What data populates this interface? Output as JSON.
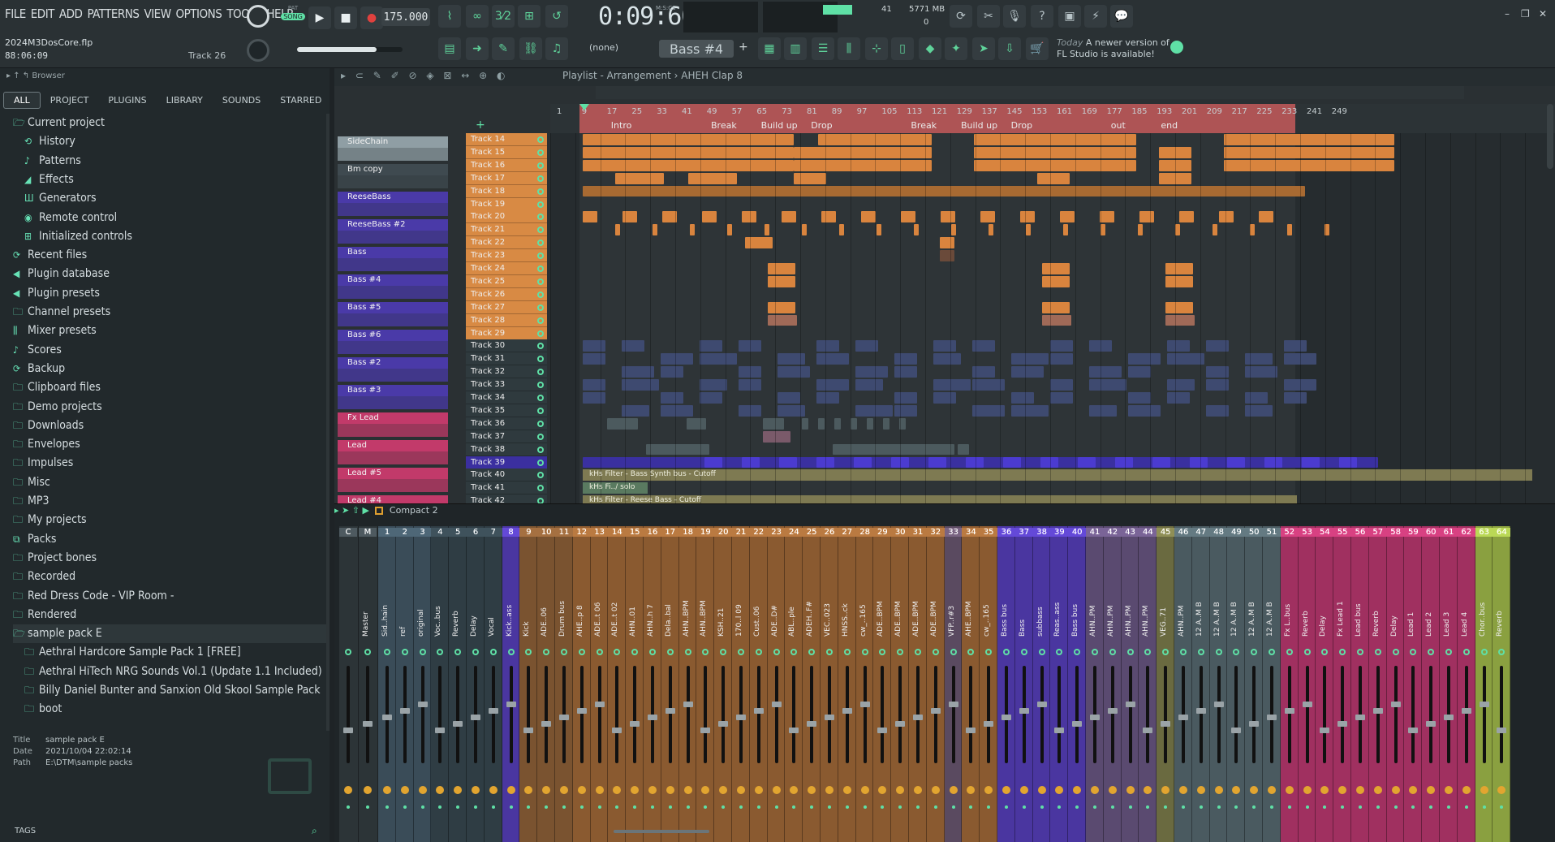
{
  "menu": [
    "FILE",
    "EDIT",
    "ADD",
    "PATTERNS",
    "VIEW",
    "OPTIONS",
    "TOOLS",
    "HELP"
  ],
  "transport": {
    "pat_label": "PAT",
    "song_label": "SONG",
    "tempo": "175.000",
    "time": "0:09:60",
    "time_unit": "M:S:CS",
    "cpu": "41",
    "memory": "5771 MB",
    "voices": "0"
  },
  "project": {
    "file": "2024M3DosCore.flp",
    "time": "88:06:09",
    "track": "Track 26"
  },
  "toolbar2": {
    "none_label": "(none)",
    "pattern": "Bass #4",
    "news_date": "Today",
    "news_text1": "A newer version of",
    "news_text2": "FL Studio is available!"
  },
  "browser": {
    "title": "Browser",
    "tabs": [
      "ALL",
      "PROJECT",
      "PLUGINS",
      "LIBRARY",
      "SOUNDS",
      "STARRED"
    ],
    "active_tab": "ALL",
    "tree": [
      {
        "label": "Current project",
        "level": 0,
        "icon": "folder-open-icon"
      },
      {
        "label": "History",
        "level": 1,
        "icon": "history-icon"
      },
      {
        "label": "Patterns",
        "level": 1,
        "icon": "note-icon"
      },
      {
        "label": "Effects",
        "level": 1,
        "icon": "effects-icon"
      },
      {
        "label": "Generators",
        "level": 1,
        "icon": "generators-icon"
      },
      {
        "label": "Remote control",
        "level": 1,
        "icon": "remote-icon"
      },
      {
        "label": "Initialized controls",
        "level": 1,
        "icon": "controls-icon"
      },
      {
        "label": "Recent files",
        "level": 0,
        "icon": "recent-icon"
      },
      {
        "label": "Plugin database",
        "level": 0,
        "icon": "plugin-icon"
      },
      {
        "label": "Plugin presets",
        "level": 0,
        "icon": "plugin-icon"
      },
      {
        "label": "Channel presets",
        "level": 0,
        "icon": "folder-icon"
      },
      {
        "label": "Mixer presets",
        "level": 0,
        "icon": "mixer-icon"
      },
      {
        "label": "Scores",
        "level": 0,
        "icon": "note-icon"
      },
      {
        "label": "Backup",
        "level": 0,
        "icon": "backup-icon"
      },
      {
        "label": "Clipboard files",
        "level": 0,
        "icon": "folder-icon"
      },
      {
        "label": "Demo projects",
        "level": 0,
        "icon": "folder-icon"
      },
      {
        "label": "Downloads",
        "level": 0,
        "icon": "folder-icon"
      },
      {
        "label": "Envelopes",
        "level": 0,
        "icon": "folder-icon"
      },
      {
        "label": "Impulses",
        "level": 0,
        "icon": "folder-icon"
      },
      {
        "label": "Misc",
        "level": 0,
        "icon": "folder-icon"
      },
      {
        "label": "MP3",
        "level": 0,
        "icon": "folder-icon"
      },
      {
        "label": "My projects",
        "level": 0,
        "icon": "folder-icon"
      },
      {
        "label": "Packs",
        "level": 0,
        "icon": "packs-icon"
      },
      {
        "label": "Project bones",
        "level": 0,
        "icon": "folder-icon"
      },
      {
        "label": "Recorded",
        "level": 0,
        "icon": "folder-icon"
      },
      {
        "label": "Red Dress Code - VIP Room -",
        "level": 0,
        "icon": "folder-icon"
      },
      {
        "label": "Rendered",
        "level": 0,
        "icon": "folder-icon"
      },
      {
        "label": "sample pack E",
        "level": 0,
        "icon": "folder-open-icon"
      },
      {
        "label": "Aethral Hardcore Sample Pack 1 [FREE]",
        "level": 1,
        "icon": "folder-icon"
      },
      {
        "label": "Aethral HiTech NRG Sounds Vol.1 (Update 1.1 Included)",
        "level": 1,
        "icon": "folder-icon"
      },
      {
        "label": "Billy Daniel Bunter and Sanxion Old Skool Sample Pack",
        "level": 1,
        "icon": "folder-icon"
      },
      {
        "label": "boot",
        "level": 1,
        "icon": "folder-icon"
      }
    ],
    "info": {
      "title_k": "Title",
      "title": "sample pack E",
      "date_k": "Date",
      "date": "2021/10/04 22:02:14",
      "path_k": "Path",
      "path": "E:\\DTM\\sample packs"
    },
    "tags_label": "TAGS"
  },
  "playlist": {
    "title": "Playlist - Arrangement › AHEH Clap 8",
    "ruler": [
      "1",
      "9",
      "17",
      "25",
      "33",
      "41",
      "49",
      "57",
      "65",
      "73",
      "81",
      "89",
      "97",
      "105",
      "113",
      "121",
      "129",
      "137",
      "145",
      "153",
      "161",
      "169",
      "177",
      "185",
      "193",
      "201",
      "209",
      "217",
      "225",
      "233",
      "241",
      "249"
    ],
    "markers": [
      {
        "label": "Intro",
        "bar": 9
      },
      {
        "label": "Break",
        "bar": 41
      },
      {
        "label": "Build up",
        "bar": 57
      },
      {
        "label": "Drop",
        "bar": 73
      },
      {
        "label": "Break",
        "bar": 105
      },
      {
        "label": "Build up",
        "bar": 121
      },
      {
        "label": "Drop",
        "bar": 137
      },
      {
        "label": "out",
        "bar": 169
      },
      {
        "label": "end",
        "bar": 185
      }
    ],
    "channels": [
      {
        "name": "SideChain",
        "color": "#8f9ea4"
      },
      {
        "name": "Bm copy",
        "color": "#3f4a50"
      },
      {
        "name": "ReeseBass",
        "color": "#4a3aa8"
      },
      {
        "name": "ReeseBass #2",
        "color": "#4a3aa8"
      },
      {
        "name": "Bass",
        "color": "#4a3aa8"
      },
      {
        "name": "Bass #4",
        "color": "#4a3aa8"
      },
      {
        "name": "Bass #5",
        "color": "#4a3aa8"
      },
      {
        "name": "Bass #6",
        "color": "#4a3aa8"
      },
      {
        "name": "Bass #2",
        "color": "#4a3aa8"
      },
      {
        "name": "Bass #3",
        "color": "#4a3aa8"
      },
      {
        "name": "Fx Lead",
        "color": "#c23a6a"
      },
      {
        "name": "Lead",
        "color": "#c23a6a"
      },
      {
        "name": "Lead #5",
        "color": "#c23a6a"
      },
      {
        "name": "Lead #4",
        "color": "#c23a6a"
      }
    ],
    "tracks": [
      "Track 14",
      "Track 15",
      "Track 16",
      "Track 17",
      "Track 18",
      "Track 19",
      "Track 20",
      "Track 21",
      "Track 22",
      "Track 23",
      "Track 24",
      "Track 25",
      "Track 26",
      "Track 27",
      "Track 28",
      "Track 29",
      "Track 30",
      "Track 31",
      "Track 32",
      "Track 33",
      "Track 34",
      "Track 35",
      "Track 36",
      "Track 37",
      "Track 38",
      "Track 39",
      "Track 40",
      "Track 41",
      "Track 42"
    ],
    "automation": [
      "kHs Filter - Bass Synth bus - Cutoff",
      "kHs Fi../ solo",
      "kHs Filter - Reese Bass - Cutoff"
    ],
    "clip_labels": [
      "AHN1..BPM",
      "AHN1..BPM",
      "AHN1.5..BPM",
      "AHN1.5..BPM",
      "AHN..BPM",
      "AHN1..BPM",
      "AHN1..BPM"
    ]
  },
  "mixer": {
    "view": "Compact 2",
    "strips": [
      {
        "num": "C",
        "name": "",
        "color": "#2c3437"
      },
      {
        "num": "M",
        "name": "Master",
        "color": "#2c3437"
      },
      {
        "num": "1",
        "name": "Sid..hain",
        "color": "#3a4c58"
      },
      {
        "num": "2",
        "name": "ref",
        "color": "#3a4c58"
      },
      {
        "num": "3",
        "name": "original",
        "color": "#3a4c58"
      },
      {
        "num": "4",
        "name": "Voc..bus",
        "color": "#2f3d44"
      },
      {
        "num": "5",
        "name": "Reverb",
        "color": "#2f3d44"
      },
      {
        "num": "6",
        "name": "Delay",
        "color": "#2f3d44"
      },
      {
        "num": "7",
        "name": "Vocal",
        "color": "#2f3d44"
      },
      {
        "num": "8",
        "name": "Kick..ass",
        "color": "#4a36a0"
      },
      {
        "num": "9",
        "name": "Kick",
        "color": "#7a5330"
      },
      {
        "num": "10",
        "name": "ADE..06",
        "color": "#7a5330"
      },
      {
        "num": "11",
        "name": "Drum bus",
        "color": "#7a5330"
      },
      {
        "num": "12",
        "name": "AHE..p 8",
        "color": "#8a5a30"
      },
      {
        "num": "13",
        "name": "ADE..t 06",
        "color": "#8a5a30"
      },
      {
        "num": "14",
        "name": "ADE..t 02",
        "color": "#8a5a30"
      },
      {
        "num": "15",
        "name": "AHN..01",
        "color": "#8a5a30"
      },
      {
        "num": "16",
        "name": "AHN..h 7",
        "color": "#8a5a30"
      },
      {
        "num": "17",
        "name": "Dela..bal",
        "color": "#8a5a30"
      },
      {
        "num": "18",
        "name": "AHN..BPM",
        "color": "#8a5a30"
      },
      {
        "num": "19",
        "name": "AHN..BPM",
        "color": "#8a5a30"
      },
      {
        "num": "20",
        "name": "KSH..21",
        "color": "#8a5a30"
      },
      {
        "num": "21",
        "name": "170..l 09",
        "color": "#8a5a30"
      },
      {
        "num": "22",
        "name": "Cust..06",
        "color": "#8a5a30"
      },
      {
        "num": "23",
        "name": "ADE..D#",
        "color": "#8a5a30"
      },
      {
        "num": "24",
        "name": "ABL..ple",
        "color": "#8a5a30"
      },
      {
        "num": "25",
        "name": "ADEH..F#",
        "color": "#8a5a30"
      },
      {
        "num": "26",
        "name": "VEC..023",
        "color": "#8a5a30"
      },
      {
        "num": "27",
        "name": "HNSS..ck",
        "color": "#8a5a30"
      },
      {
        "num": "28",
        "name": "cw_..165",
        "color": "#8a5a30"
      },
      {
        "num": "29",
        "name": "ADE..BPM",
        "color": "#8a5a30"
      },
      {
        "num": "30",
        "name": "ADE..BPM",
        "color": "#8a5a30"
      },
      {
        "num": "31",
        "name": "ADE..BPM",
        "color": "#8a5a30"
      },
      {
        "num": "32",
        "name": "ADE..BPM",
        "color": "#8a5a30"
      },
      {
        "num": "33",
        "name": "VFP..r#3",
        "color": "#5a4a60"
      },
      {
        "num": "34",
        "name": "AHE..BPM",
        "color": "#8a5a30"
      },
      {
        "num": "35",
        "name": "cw_..165",
        "color": "#8a5a30"
      },
      {
        "num": "36",
        "name": "Bass bus",
        "color": "#4a36a0"
      },
      {
        "num": "37",
        "name": "Bass",
        "color": "#4a36a0"
      },
      {
        "num": "38",
        "name": "subbass",
        "color": "#4a36a0"
      },
      {
        "num": "39",
        "name": "Reas..ass",
        "color": "#4a36a0"
      },
      {
        "num": "40",
        "name": "Bass bus",
        "color": "#4a36a0"
      },
      {
        "num": "41",
        "name": "AHN..PM",
        "color": "#5a4a70"
      },
      {
        "num": "42",
        "name": "AHN..PM",
        "color": "#5a4a70"
      },
      {
        "num": "43",
        "name": "AHN..PM",
        "color": "#5a4a70"
      },
      {
        "num": "44",
        "name": "AHN..PM",
        "color": "#5a4a70"
      },
      {
        "num": "45",
        "name": "VEG..71",
        "color": "#6a6a40"
      },
      {
        "num": "46",
        "name": "AHN..PM",
        "color": "#4a5a60"
      },
      {
        "num": "47",
        "name": "12 A..M B",
        "color": "#4a5a60"
      },
      {
        "num": "48",
        "name": "12 A..M B",
        "color": "#4a5a60"
      },
      {
        "num": "49",
        "name": "12 A..M B",
        "color": "#4a5a60"
      },
      {
        "num": "50",
        "name": "12 A..M B",
        "color": "#4a5a60"
      },
      {
        "num": "51",
        "name": "12 A..M B",
        "color": "#4a5a60"
      },
      {
        "num": "52",
        "name": "Fx L..bus",
        "color": "#a03060"
      },
      {
        "num": "53",
        "name": "Reverb",
        "color": "#a03060"
      },
      {
        "num": "54",
        "name": "Delay",
        "color": "#a03060"
      },
      {
        "num": "55",
        "name": "Fx Lead 1",
        "color": "#a03060"
      },
      {
        "num": "56",
        "name": "Lead bus",
        "color": "#a03060"
      },
      {
        "num": "57",
        "name": "Reverb",
        "color": "#a03060"
      },
      {
        "num": "58",
        "name": "Delay",
        "color": "#a03060"
      },
      {
        "num": "59",
        "name": "Lead 1",
        "color": "#a03060"
      },
      {
        "num": "60",
        "name": "Lead 2",
        "color": "#a03060"
      },
      {
        "num": "61",
        "name": "Lead 3",
        "color": "#a03060"
      },
      {
        "num": "62",
        "name": "Lead 4",
        "color": "#a03060"
      },
      {
        "num": "63",
        "name": "Chor..bus",
        "color": "#8aa040"
      },
      {
        "num": "64",
        "name": "Reverb",
        "color": "#8aa040"
      }
    ]
  },
  "colors": {
    "accent": "#5fe0a6",
    "orange_clip": "#e0904a",
    "purple": "#4a3aa8",
    "pink": "#c23a6a",
    "bg": "#1e2326"
  }
}
